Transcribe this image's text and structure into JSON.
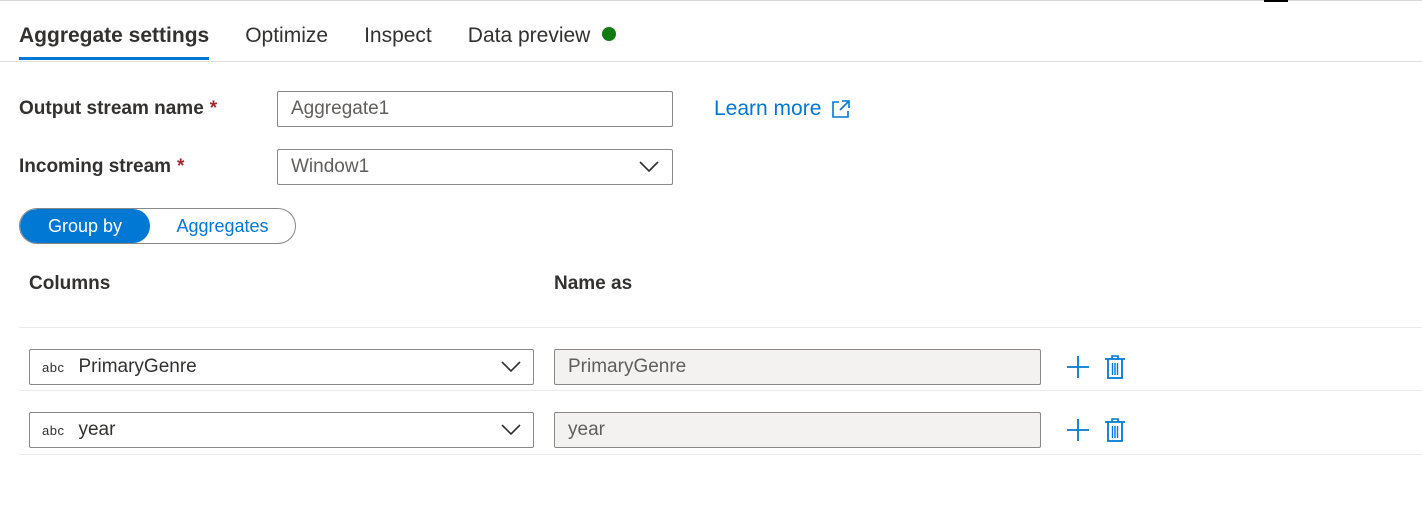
{
  "tabs": [
    {
      "label": "Aggregate settings",
      "active": true
    },
    {
      "label": "Optimize",
      "active": false
    },
    {
      "label": "Inspect",
      "active": false
    },
    {
      "label": "Data preview",
      "active": false,
      "status_color": "#107c10"
    }
  ],
  "form": {
    "output_stream_label": "Output stream name",
    "required_marker": "*",
    "output_stream_value": "Aggregate1",
    "incoming_stream_label": "Incoming stream",
    "incoming_stream_value": "Window1",
    "learn_more_label": "Learn more"
  },
  "toggle": {
    "group_by_label": "Group by",
    "aggregates_label": "Aggregates",
    "selected": "Group by"
  },
  "table": {
    "columns_header": "Columns",
    "name_as_header": "Name as",
    "rows": [
      {
        "type": "abc",
        "column": "PrimaryGenre",
        "name_as": "PrimaryGenre"
      },
      {
        "type": "abc",
        "column": "year",
        "name_as": "year"
      }
    ]
  },
  "colors": {
    "accent": "#0078d4",
    "required": "#a4262c",
    "status_ok": "#107c10"
  },
  "icons": {
    "external_link": "external-link-icon",
    "chevron": "chevron-down-icon",
    "add": "plus-icon",
    "delete": "trash-icon"
  }
}
